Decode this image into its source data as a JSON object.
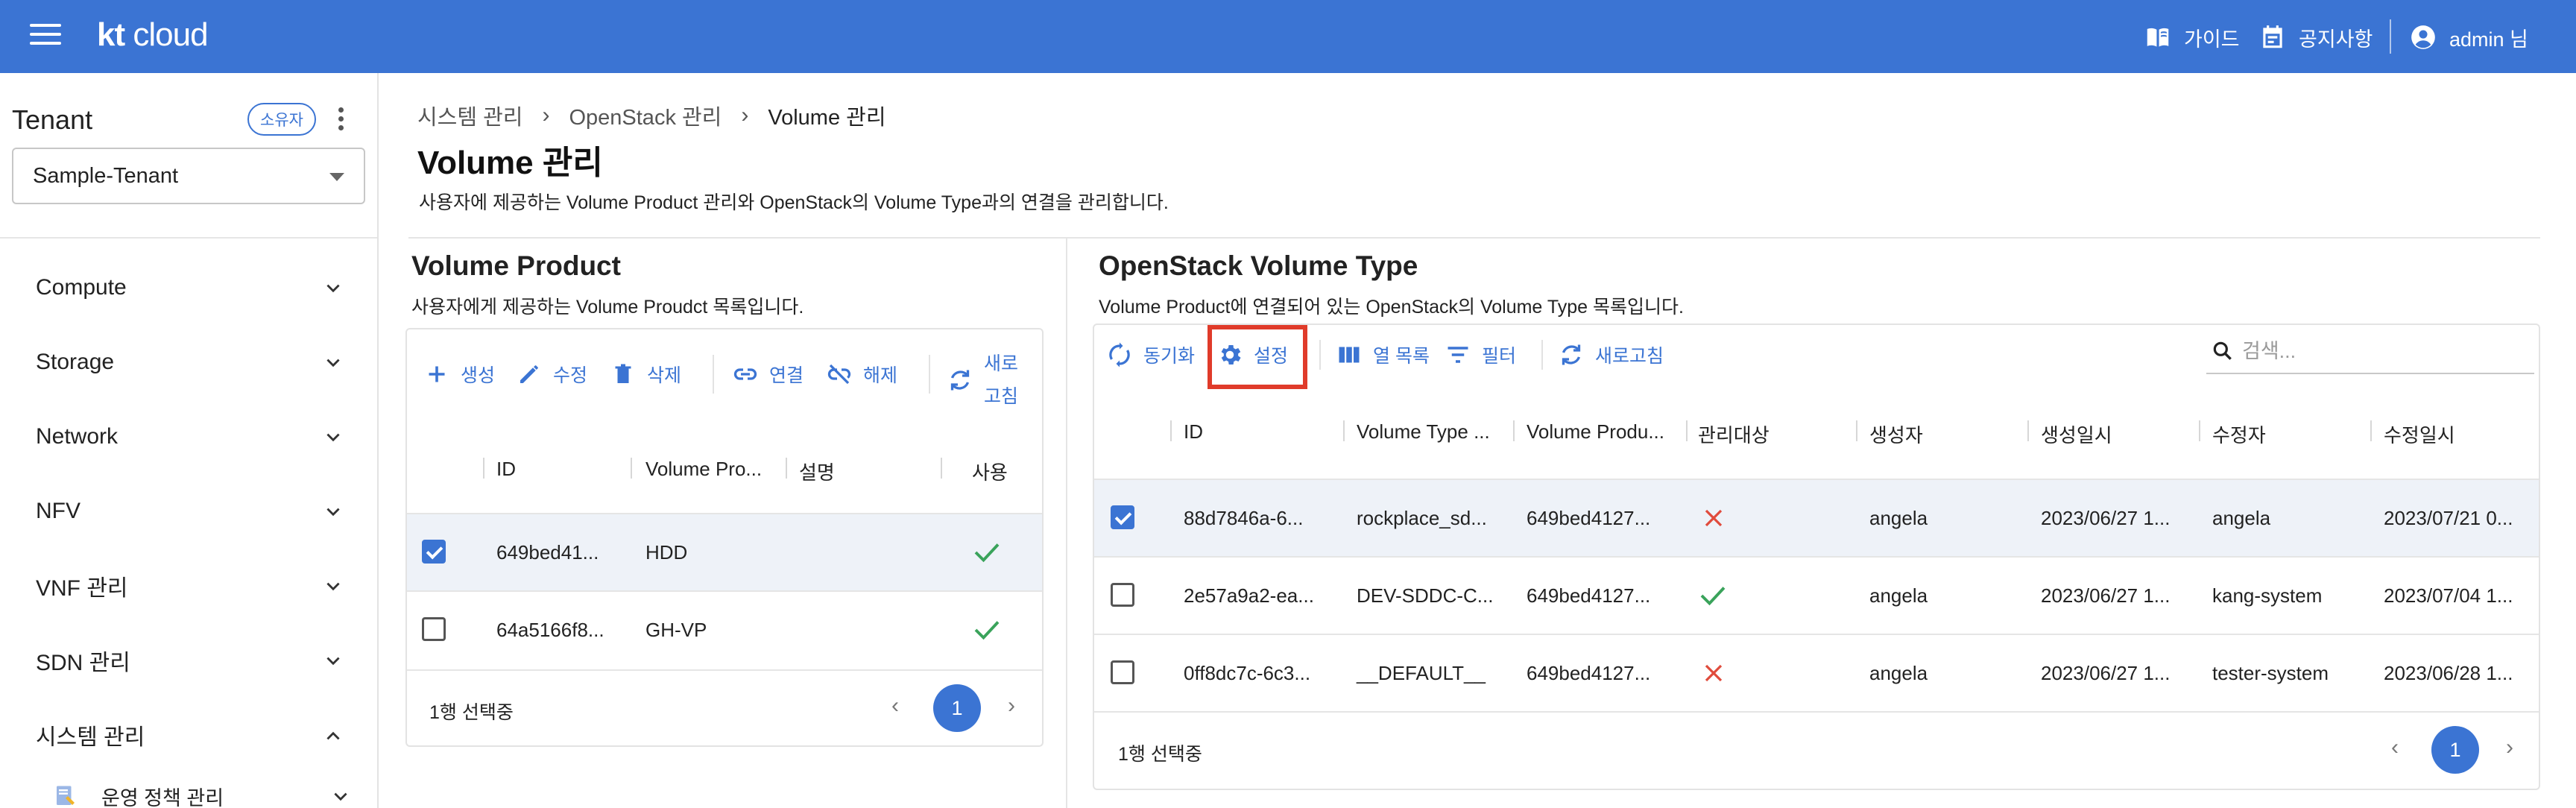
{
  "header": {
    "logo_kt": "kt",
    "logo_cloud": "cloud",
    "guide_label": "가이드",
    "notice_label": "공지사항",
    "user_label": "admin 님"
  },
  "sidebar": {
    "tenant_title": "Tenant",
    "owner_chip": "소유자",
    "tenant_value": "Sample-Tenant",
    "items": [
      {
        "label": "Compute"
      },
      {
        "label": "Storage"
      },
      {
        "label": "Network"
      },
      {
        "label": "NFV"
      },
      {
        "label": "VNF 관리"
      },
      {
        "label": "SDN 관리"
      },
      {
        "label": "시스템 관리"
      }
    ],
    "sub_item": "운영 정책 관리"
  },
  "breadcrumb": [
    "시스템 관리",
    "OpenStack 관리",
    "Volume 관리"
  ],
  "page": {
    "title": "Volume 관리",
    "description": "사용자에 제공하는 Volume Product 관리와 OpenStack의 Volume Type과의 연결을 관리합니다."
  },
  "volume_product": {
    "title": "Volume Product",
    "description": "사용자에게 제공하는 Volume Proudct 목록입니다.",
    "toolbar": {
      "create": "생성",
      "edit": "수정",
      "delete": "삭제",
      "connect": "연결",
      "disconnect": "해제",
      "refresh_line1": "새로",
      "refresh_line2": "고침"
    },
    "columns": [
      "ID",
      "Volume Pro...",
      "설명",
      "사용"
    ],
    "rows": [
      {
        "id": "649bed41...",
        "product": "HDD",
        "desc": "",
        "use": "check",
        "selected": true
      },
      {
        "id": "64a5166f8...",
        "product": "GH-VP",
        "desc": "",
        "use": "check",
        "selected": false
      }
    ],
    "footer": "1행 선택중",
    "page": "1"
  },
  "volume_type": {
    "title": "OpenStack Volume Type",
    "description": "Volume Product에 연결되어 있는 OpenStack의 Volume Type 목록입니다.",
    "toolbar": {
      "sync": "동기화",
      "settings": "설정",
      "columns": "열 목록",
      "filter": "필터",
      "refresh": "새로고침"
    },
    "search_placeholder": "검색...",
    "columns": [
      "ID",
      "Volume Type ...",
      "Volume Produ...",
      "관리대상",
      "생성자",
      "생성일시",
      "수정자",
      "수정일시"
    ],
    "rows": [
      {
        "id": "88d7846a-6...",
        "type": "rockplace_sd...",
        "product": "649bed4127...",
        "managed": "x",
        "creator": "angela",
        "created": "2023/06/27 1...",
        "modifier": "angela",
        "modified": "2023/07/21 0...",
        "selected": true
      },
      {
        "id": "2e57a9a2-ea...",
        "type": "DEV-SDDC-C...",
        "product": "649bed4127...",
        "managed": "check",
        "creator": "angela",
        "created": "2023/06/27 1...",
        "modifier": "kang-system",
        "modified": "2023/07/04 1...",
        "selected": false
      },
      {
        "id": "0ff8dc7c-6c3...",
        "type": "__DEFAULT__",
        "product": "649bed4127...",
        "managed": "x",
        "creator": "angela",
        "created": "2023/06/27 1...",
        "modifier": "tester-system",
        "modified": "2023/06/28 1...",
        "selected": false
      }
    ],
    "footer": "1행 선택중",
    "page": "1"
  },
  "colors": {
    "primary": "#3b74d3",
    "check_green": "#3aa35b",
    "x_red": "#e04b3c",
    "highlight_red": "#e03b2a"
  }
}
